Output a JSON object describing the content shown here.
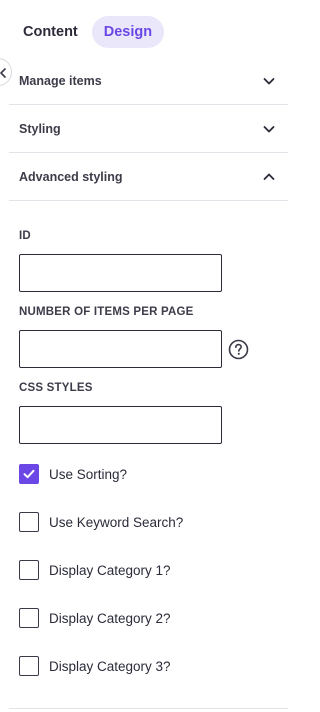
{
  "tabs": [
    {
      "label": "Content",
      "active": false
    },
    {
      "label": "Design",
      "active": true
    }
  ],
  "sections": [
    {
      "label": "Manage items",
      "expanded": false
    },
    {
      "label": "Styling",
      "expanded": false
    },
    {
      "label": "Advanced styling",
      "expanded": true
    }
  ],
  "fields": {
    "id": {
      "label": "ID",
      "value": ""
    },
    "items_per_page": {
      "label": "NUMBER OF ITEMS PER PAGE",
      "value": ""
    },
    "css_styles": {
      "label": "CSS STYLES",
      "value": ""
    }
  },
  "checkboxes": [
    {
      "label": "Use Sorting?",
      "checked": true
    },
    {
      "label": "Use Keyword Search?",
      "checked": false
    },
    {
      "label": "Display Category 1?",
      "checked": false
    },
    {
      "label": "Display Category 2?",
      "checked": false
    },
    {
      "label": "Display Category 3?",
      "checked": false
    }
  ],
  "colors": {
    "accent": "#6b47e6",
    "accent_soft": "#ebe7fb",
    "text": "#2b2b3a",
    "divider": "#e2e2e8"
  },
  "icons": {
    "collapse": "chevron-left-icon",
    "section_closed": "chevron-down-icon",
    "section_open": "chevron-up-icon",
    "help": "question-circle-icon",
    "check": "checkmark-icon"
  }
}
